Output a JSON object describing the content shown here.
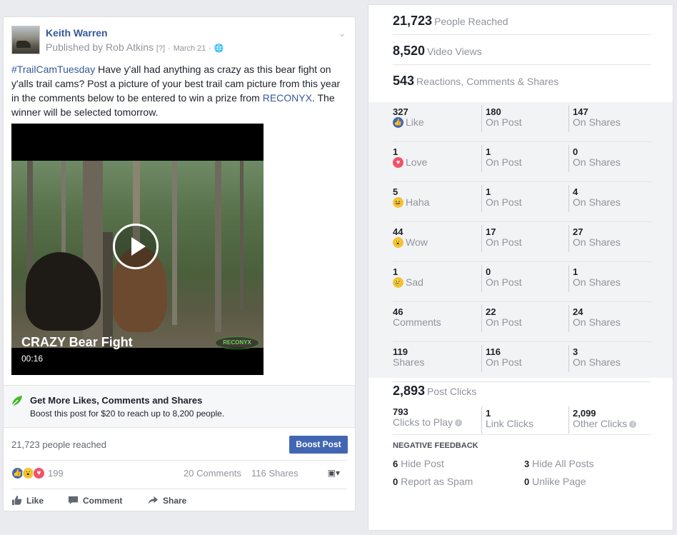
{
  "post": {
    "author": "Keith Warren",
    "published_by": "Published by Rob Atkins",
    "help_marker": "[?]",
    "date": "March 21",
    "text": {
      "hashtag": "#TrailCamTuesday",
      "body_part1": " Have y'all had anything as crazy as this bear fight on y'alls trail cams? Post a picture of your best trail cam picture from this year in the comments below to be entered to win a prize from ",
      "mention": "RECONYX",
      "body_part2": ". The winner will be selected tomorrow."
    },
    "video": {
      "title": "CRAZY Bear Fight",
      "duration": "00:16",
      "watermark": "RECONYX"
    },
    "promo": {
      "title": "Get More Likes, Comments and Shares",
      "subtitle": "Boost this post for $20 to reach up to 8,200 people."
    },
    "reached": "21,723 people reached",
    "boost_button": "Boost Post",
    "reaction_count": "199",
    "comments": "20 Comments",
    "shares": "116 Shares",
    "actions": {
      "like": "Like",
      "comment": "Comment",
      "share": "Share"
    }
  },
  "insights": {
    "people_reached": {
      "value": "21,723",
      "label": "People Reached"
    },
    "video_views": {
      "value": "8,520",
      "label": "Video Views"
    },
    "engagement": {
      "value": "543",
      "label": "Reactions, Comments & Shares"
    },
    "breakdown": [
      {
        "value": "327",
        "label": "Like",
        "icon": "like",
        "on_post": "180",
        "on_shares": "147"
      },
      {
        "value": "1",
        "label": "Love",
        "icon": "love",
        "on_post": "1",
        "on_shares": "0"
      },
      {
        "value": "5",
        "label": "Haha",
        "icon": "haha",
        "on_post": "1",
        "on_shares": "4"
      },
      {
        "value": "44",
        "label": "Wow",
        "icon": "wow",
        "on_post": "17",
        "on_shares": "27"
      },
      {
        "value": "1",
        "label": "Sad",
        "icon": "sad",
        "on_post": "0",
        "on_shares": "1"
      },
      {
        "value": "46",
        "label": "Comments",
        "icon": "",
        "on_post": "22",
        "on_shares": "24"
      },
      {
        "value": "119",
        "label": "Shares",
        "icon": "",
        "on_post": "116",
        "on_shares": "3"
      }
    ],
    "on_post_label": "On Post",
    "on_shares_label": "On Shares",
    "post_clicks": {
      "value": "2,893",
      "label": "Post Clicks"
    },
    "clicks": [
      {
        "value": "793",
        "label": "Clicks to Play",
        "info": true
      },
      {
        "value": "1",
        "label": "Link Clicks",
        "info": false
      },
      {
        "value": "2,099",
        "label": "Other Clicks",
        "info": true
      }
    ],
    "negative_title": "NEGATIVE FEEDBACK",
    "negative": {
      "hide_post": {
        "value": "6",
        "label": "Hide Post"
      },
      "hide_all": {
        "value": "3",
        "label": "Hide All Posts"
      },
      "report_spam": {
        "value": "0",
        "label": "Report as Spam"
      },
      "unlike_page": {
        "value": "0",
        "label": "Unlike Page"
      }
    }
  },
  "colors": {
    "link": "#365899",
    "boost": "#4267b2",
    "muted": "#90949c"
  }
}
